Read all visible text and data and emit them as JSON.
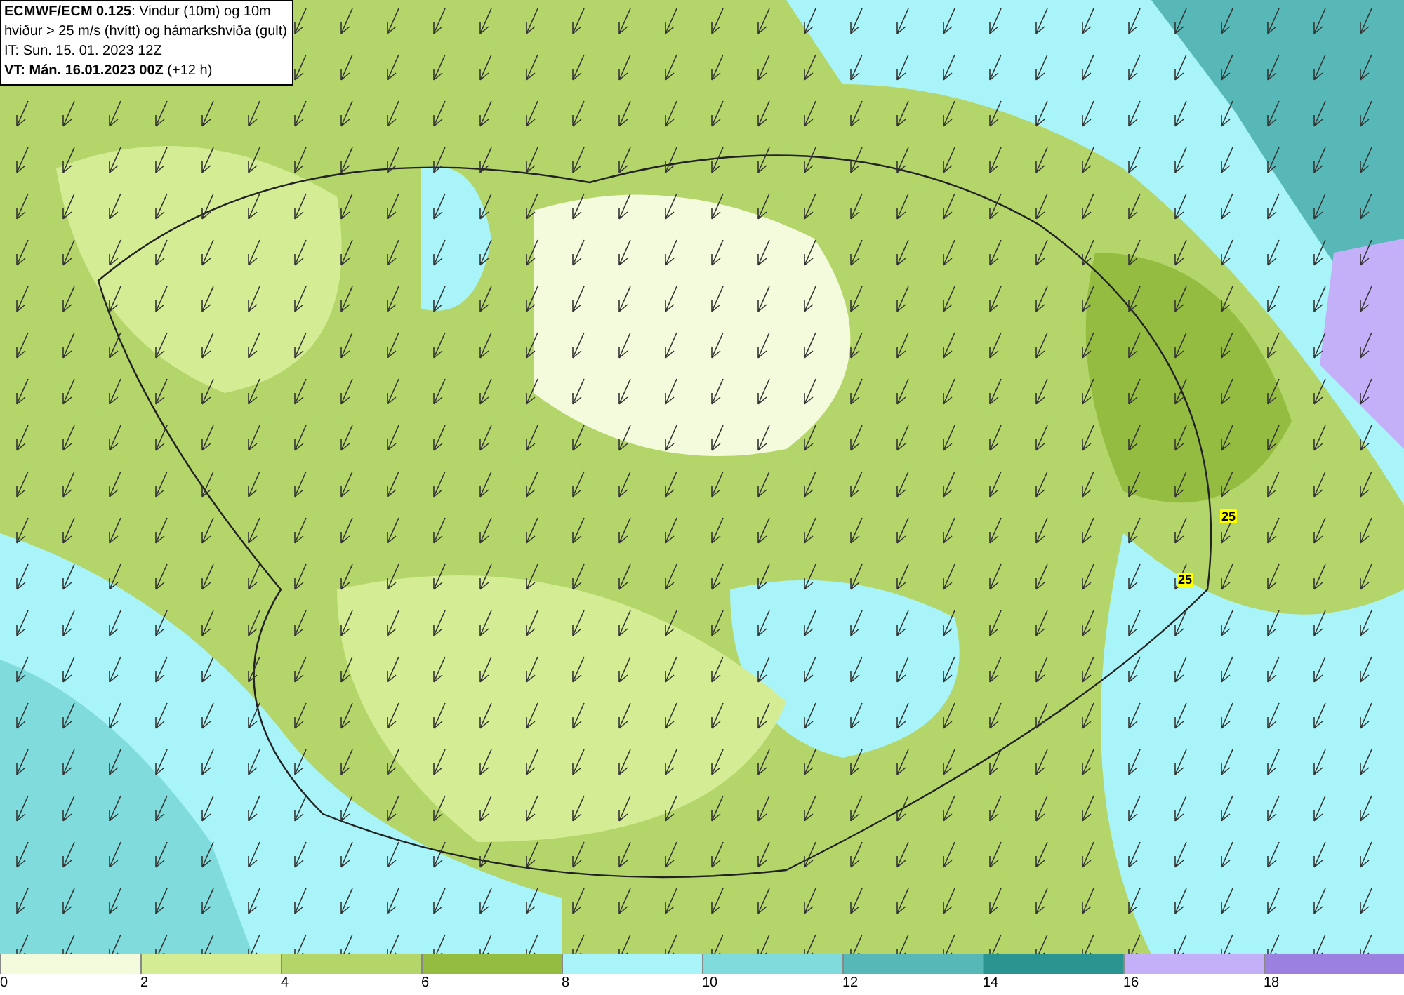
{
  "header": {
    "lines": [
      "**ECMWF/ECM 0.125**: Vindur (10m) og 10m",
      "hviður > 25 m/s (hvítt) og hámarkshviða (gult)",
      "IT: Sun. 15. 01. 2023 12Z",
      "**VT: Mán. 16.01.2023 00Z** (+12 h)"
    ]
  },
  "map": {
    "gust_labels": [
      "25",
      "25"
    ]
  },
  "legend": [
    {
      "label": "0",
      "color": "#f4fbdc"
    },
    {
      "label": "2",
      "color": "#d4ec94"
    },
    {
      "label": "4",
      "color": "#b4d56a"
    },
    {
      "label": "6",
      "color": "#94bc40"
    },
    {
      "label": "8",
      "color": "#a8f4f8"
    },
    {
      "label": "10",
      "color": "#80dcdc"
    },
    {
      "label": "12",
      "color": "#58b8b8"
    },
    {
      "label": "14",
      "color": "#2a9490"
    },
    {
      "label": "16",
      "color": "#c4b0f8"
    },
    {
      "label": "18",
      "color": "#9c80e0"
    }
  ]
}
